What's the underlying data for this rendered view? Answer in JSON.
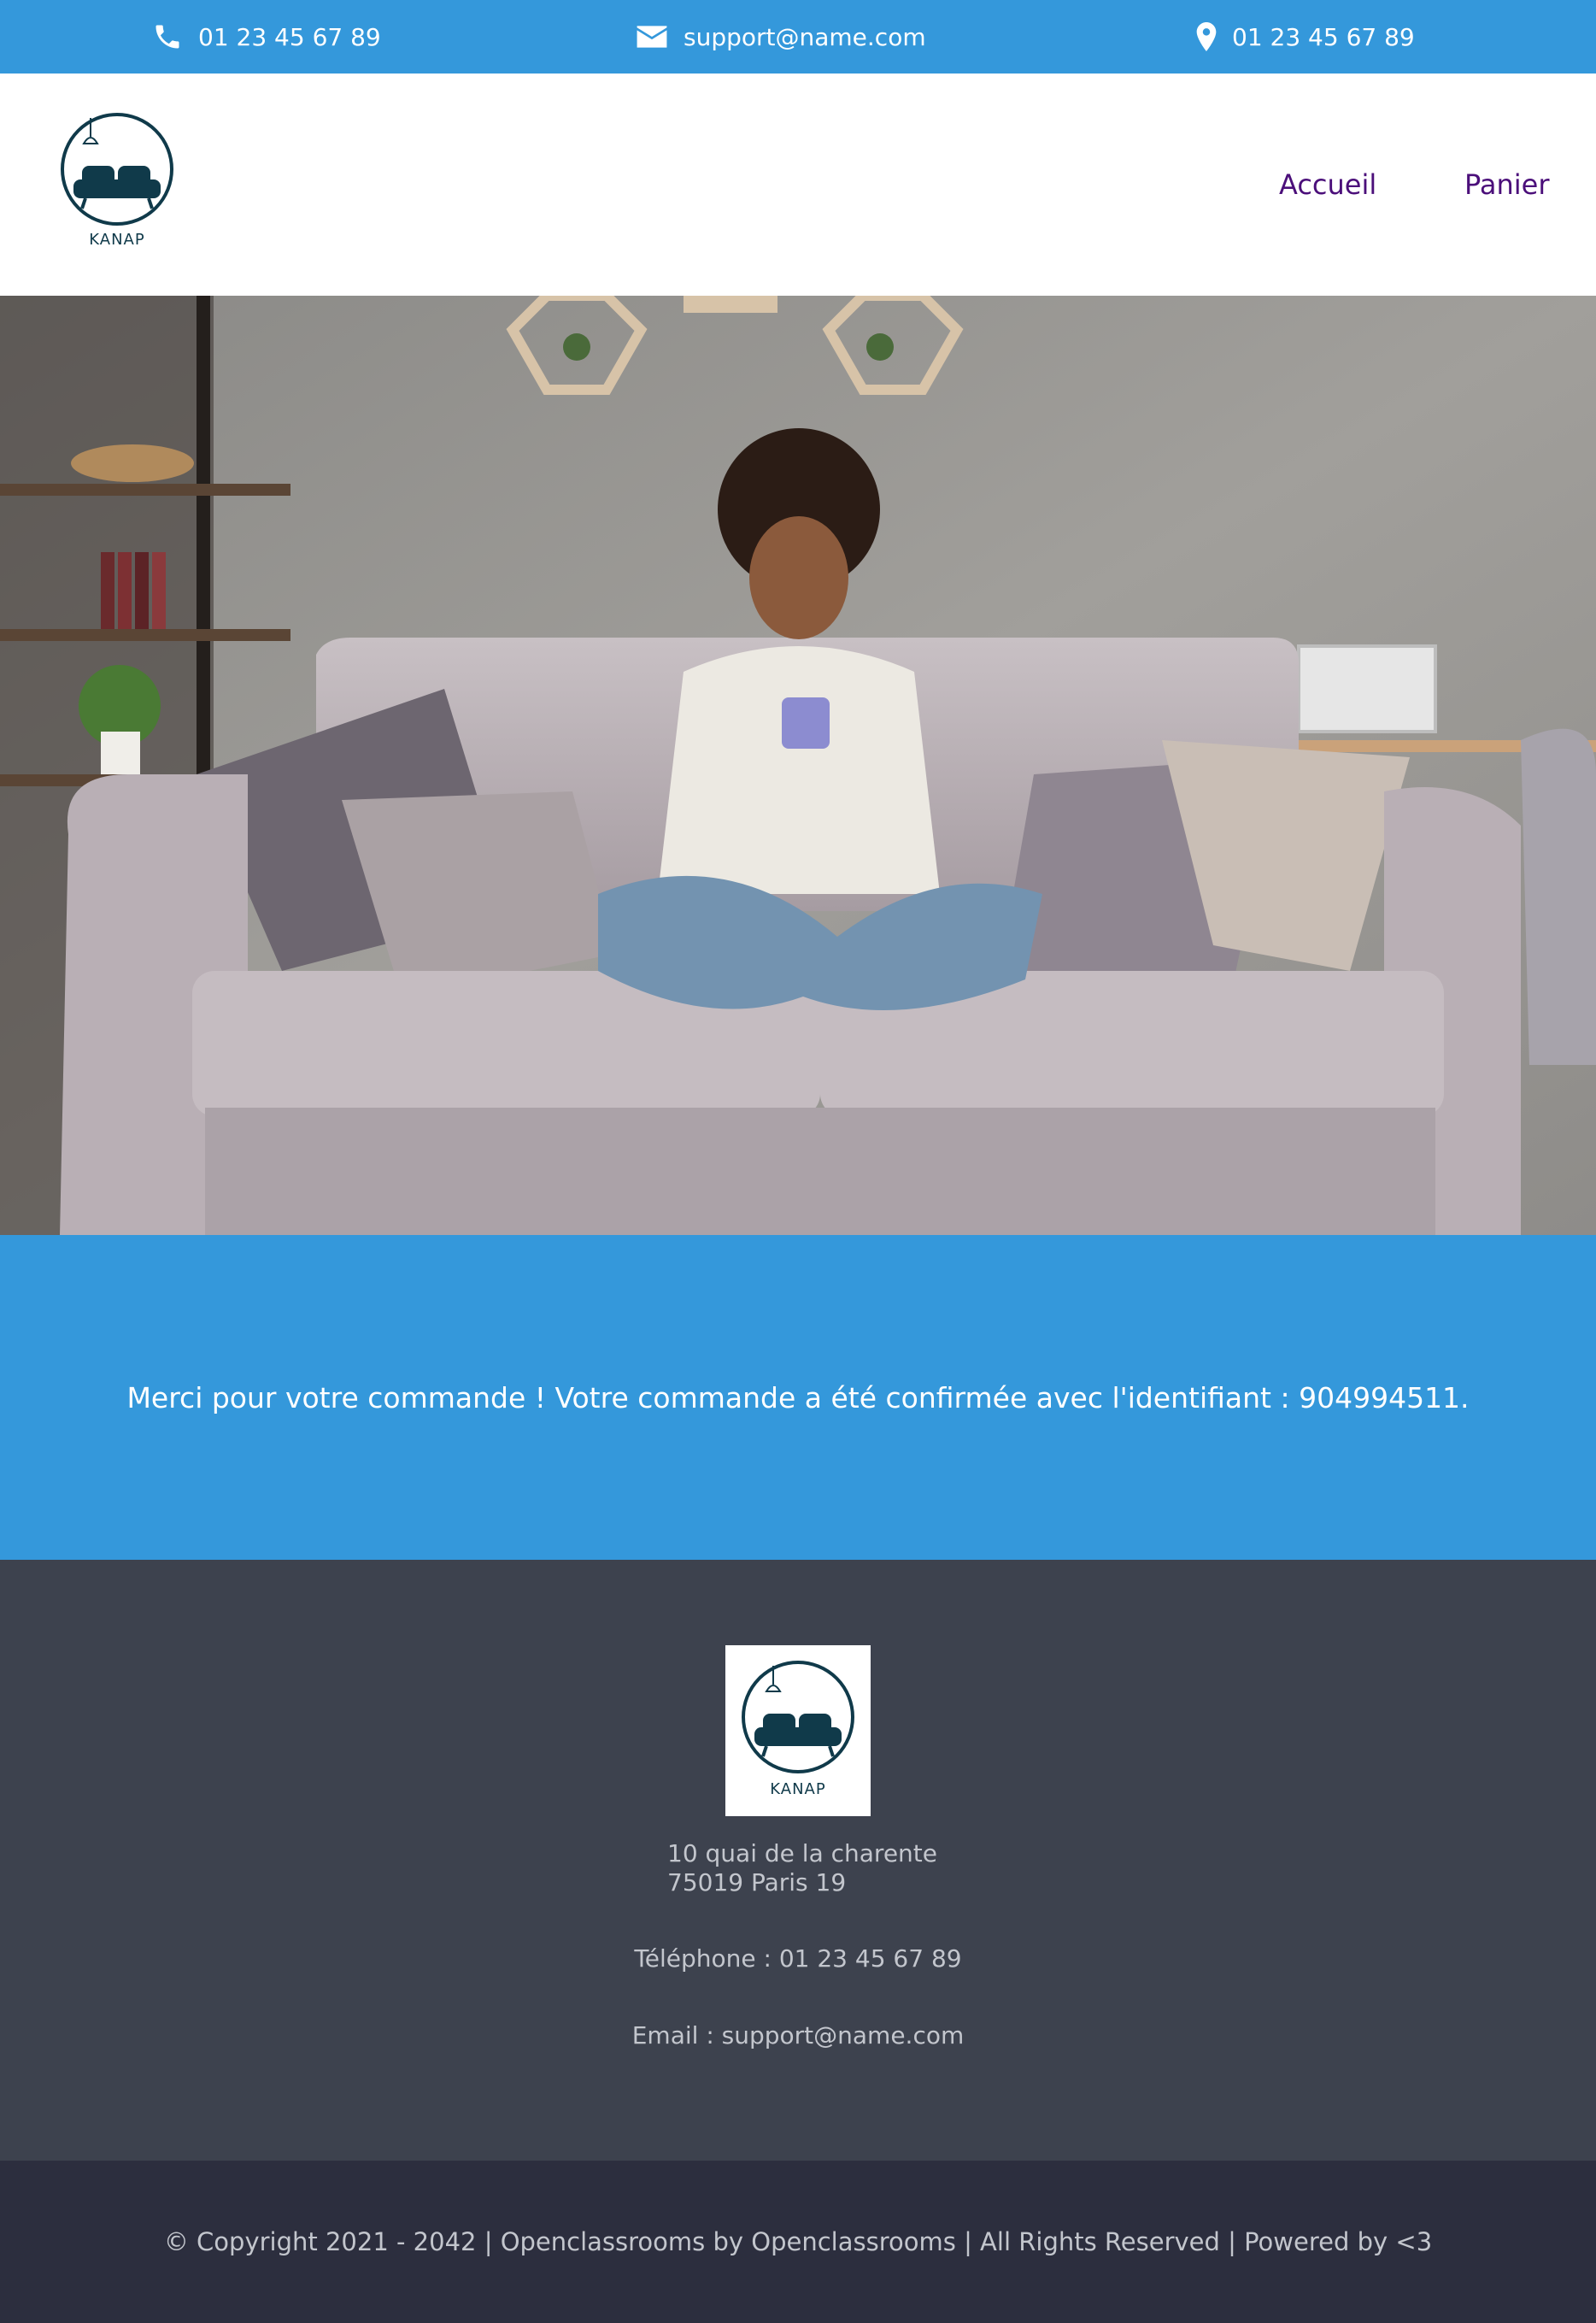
{
  "topbar": {
    "phone": "01 23 45 67 89",
    "email": "support@name.com",
    "address": "01 23 45 67 89",
    "icons": [
      "phone-icon",
      "envelope-icon",
      "map-pin-icon"
    ],
    "background": "#3498db"
  },
  "header": {
    "logo_text": "KANAP",
    "nav": [
      {
        "label": "Accueil"
      },
      {
        "label": "Panier"
      }
    ],
    "nav_color": "#4b0f7a"
  },
  "confirmation": {
    "message": "Merci pour votre commande ! Votre commande a été confirmée avec l'identifiant : 904994511."
  },
  "footer": {
    "logo_text": "KANAP",
    "address_line1": "10 quai de la charente",
    "address_line2": "75019 Paris 19",
    "phone": "Téléphone : 01 23 45 67 89",
    "email": "Email : support@name.com",
    "background": "#3d424e"
  },
  "copyright": {
    "text": "© Copyright 2021 - 2042 | Openclassrooms by Openclassrooms | All Rights Reserved | Powered by <3",
    "background": "#2c2e3e"
  }
}
